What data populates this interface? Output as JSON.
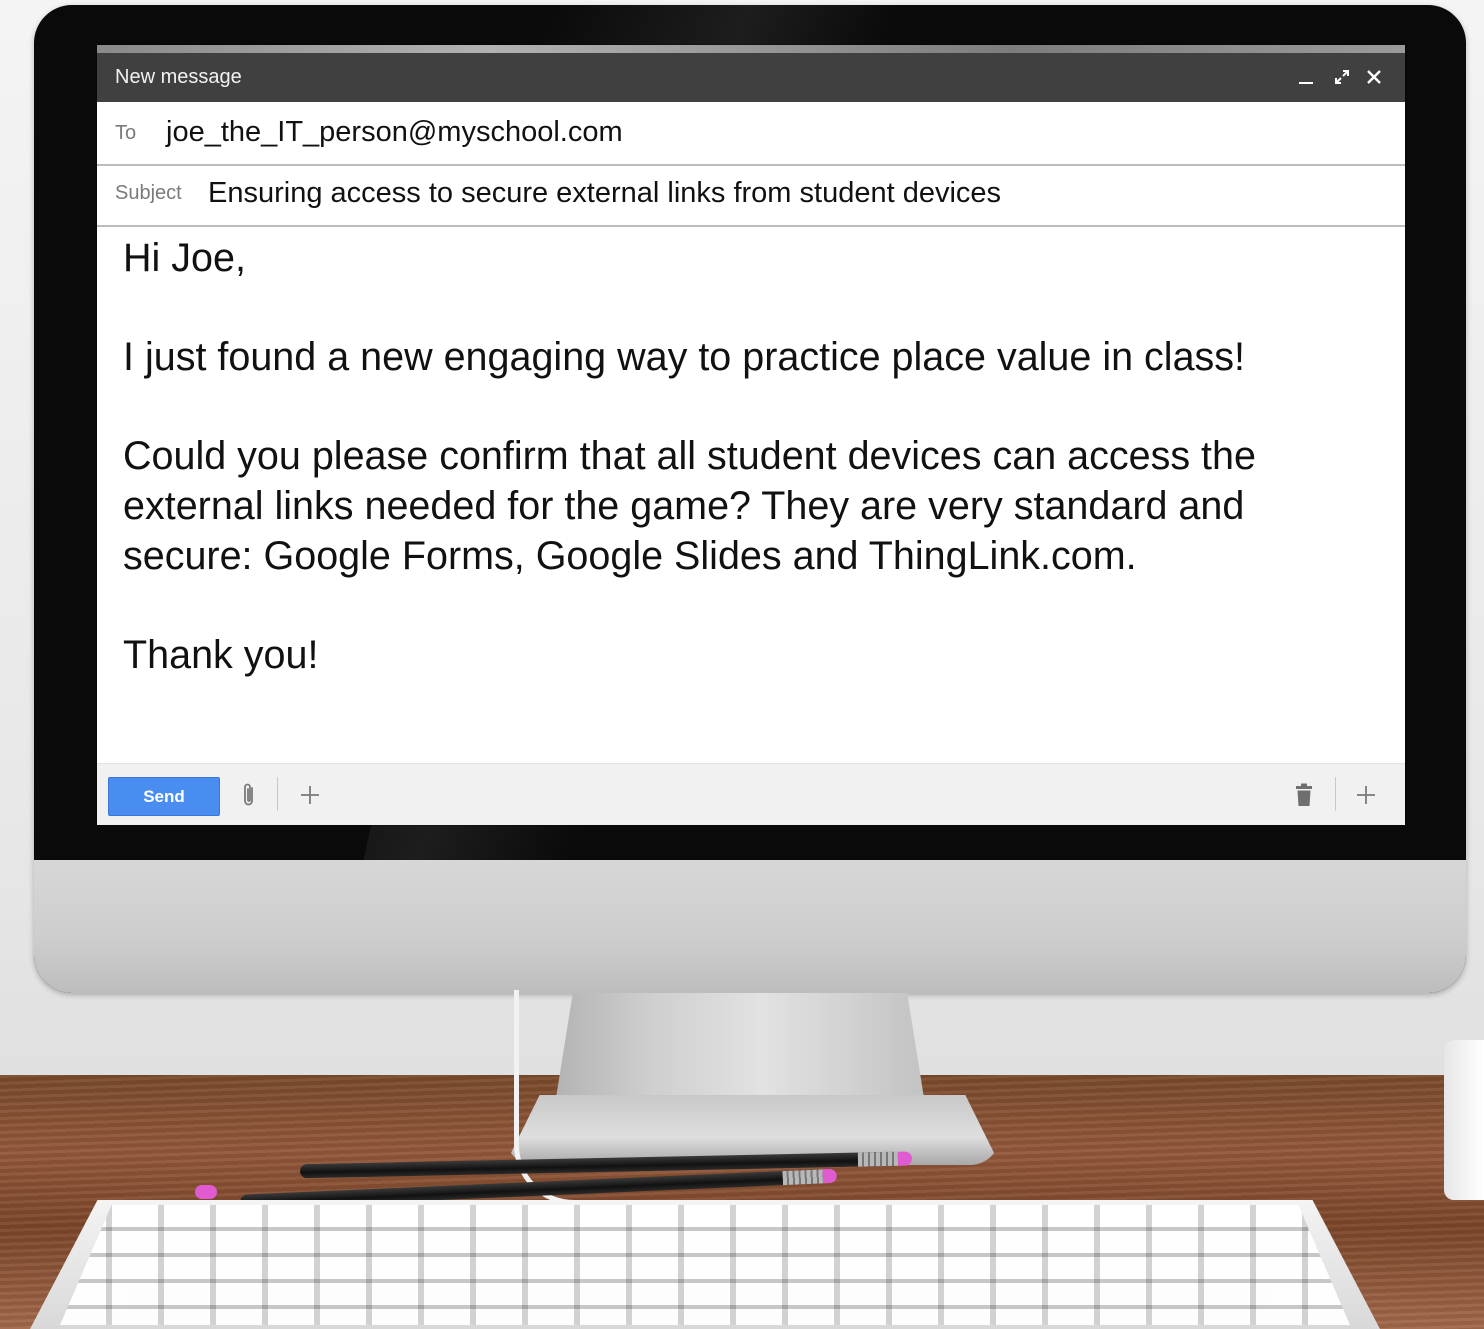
{
  "compose": {
    "title": "New message",
    "to_label": "To",
    "to_value": "joe_the_IT_person@myschool.com",
    "subject_label": "Subject",
    "subject_value": "Ensuring access to secure external links from student devices",
    "body": {
      "greeting": "Hi Joe,",
      "paragraph1": "I just found a new engaging way to practice place value in class!",
      "paragraph2": "Could you please confirm that all student devices can access the external links needed for the game? They are very standard and secure: Google Forms, Google Slides and ThingLink.com.",
      "closing": "Thank you!"
    },
    "send_label": "Send",
    "icons": {
      "minimize": "minimize-icon",
      "popout": "popout-icon",
      "close": "close-icon",
      "attach": "paperclip-icon",
      "more": "plus-icon",
      "discard": "trash-icon",
      "more_options": "plus-icon"
    },
    "colors": {
      "titlebar": "#404040",
      "send_button": "#4a8df0"
    }
  }
}
